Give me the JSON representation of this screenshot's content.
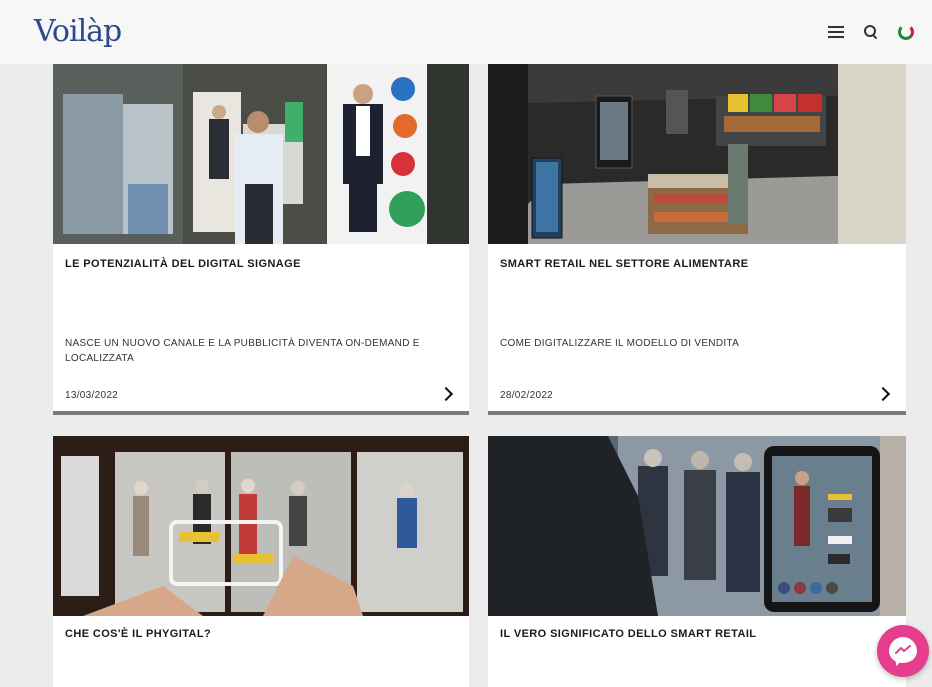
{
  "header": {
    "logo_text": "Voilàp",
    "icons": [
      "hamburger-menu-icon",
      "search-icon",
      "language-flag-icon"
    ]
  },
  "colors": {
    "logo": "#2c4a8a",
    "card_bar": "#7a7a7a",
    "messenger": "#e63e8f",
    "flag_green": "#1f8a3b",
    "flag_red": "#c8262c"
  },
  "cards": [
    {
      "title": "LE POTENZIALITÀ DEL DIGITAL SIGNAGE",
      "subtitle": "NASCE UN NUOVO CANALE E LA PUBBLICITÀ DIVENTA ON-DEMAND E LOCALIZZATA",
      "date": "13/03/2022"
    },
    {
      "title": "SMART RETAIL NEL SETTORE ALIMENTARE",
      "subtitle": "COME DIGITALIZZARE IL MODELLO DI VENDITA",
      "date": "28/02/2022"
    },
    {
      "title": "CHE COS'È IL PHYGITAL?"
    },
    {
      "title": "IL VERO SIGNIFICATO DELLO SMART RETAIL"
    }
  ],
  "chat_widget": {
    "icon": "messenger-icon"
  }
}
